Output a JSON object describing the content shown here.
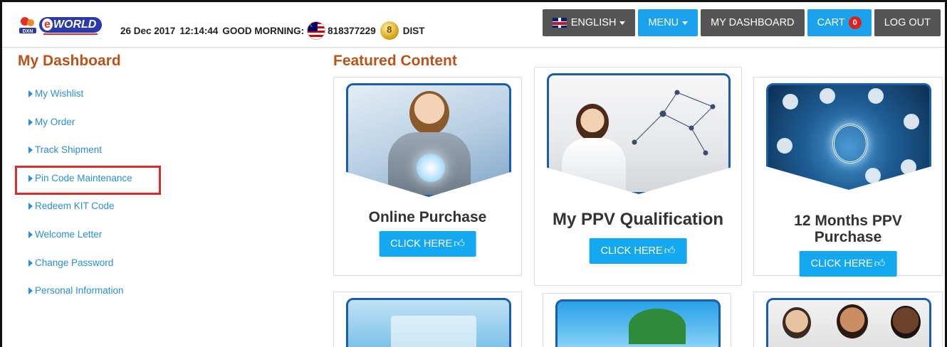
{
  "header": {
    "brand": "eWORLD",
    "brand_sub": "DXN",
    "date": "26 Dec 2017",
    "time": "12:14:44",
    "greeting": "GOOD MORNING:",
    "member_id": "818377229",
    "member_type": "DIST",
    "nav": {
      "language": "ENGLISH",
      "menu": "MENU",
      "dashboard": "MY DASHBOARD",
      "cart": "CART",
      "cart_count": "0",
      "logout": "LOG OUT"
    }
  },
  "sidebar": {
    "title": "My Dashboard",
    "items": [
      {
        "label": "My Wishlist"
      },
      {
        "label": "My Order"
      },
      {
        "label": "Track Shipment"
      },
      {
        "label": "Pin Code Maintenance"
      },
      {
        "label": "Redeem KIT Code"
      },
      {
        "label": "Welcome Letter"
      },
      {
        "label": "Change Password"
      },
      {
        "label": "Personal Information"
      }
    ]
  },
  "featured": {
    "title": "Featured Content",
    "cta_label": "CLICK HERE",
    "cards": [
      {
        "title": "Online Purchase"
      },
      {
        "title": "My PPV Qualification"
      },
      {
        "title_line1": "12 Months PPV",
        "title_line2": "Purchase"
      }
    ]
  },
  "colors": {
    "accent_blue": "#1aa3ec",
    "heading_orange": "#b8531c",
    "link_blue": "#2a8fd6",
    "highlight_red": "#d92d2d"
  }
}
